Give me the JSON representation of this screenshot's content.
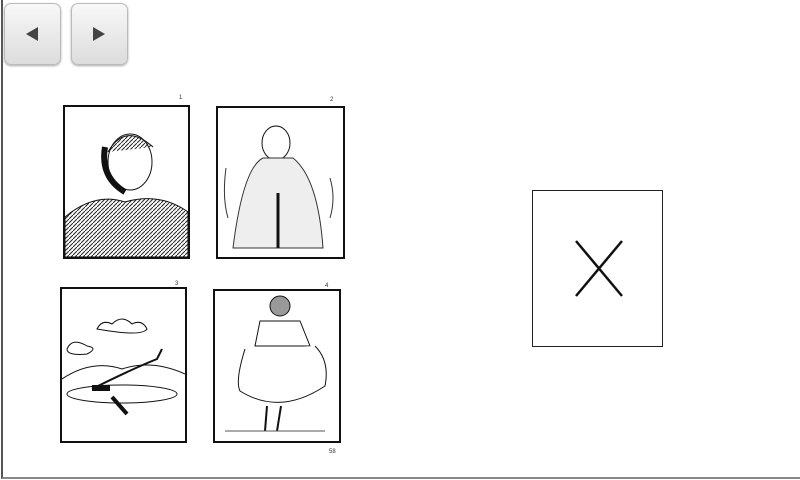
{
  "toolbar": {
    "back_icon": "triangle-left-icon",
    "forward_icon": "triangle-right-icon"
  },
  "pictures": [
    {
      "number": "1",
      "subject": "man-on-telephone"
    },
    {
      "number": "2",
      "subject": "shivering-person-in-blanket"
    },
    {
      "number": "3",
      "subject": "airplane-with-clouds"
    },
    {
      "number": "4",
      "subject": "woman-holding-skirt"
    }
  ],
  "page_number": "58",
  "answer": {
    "icon": "x-mark-icon"
  }
}
